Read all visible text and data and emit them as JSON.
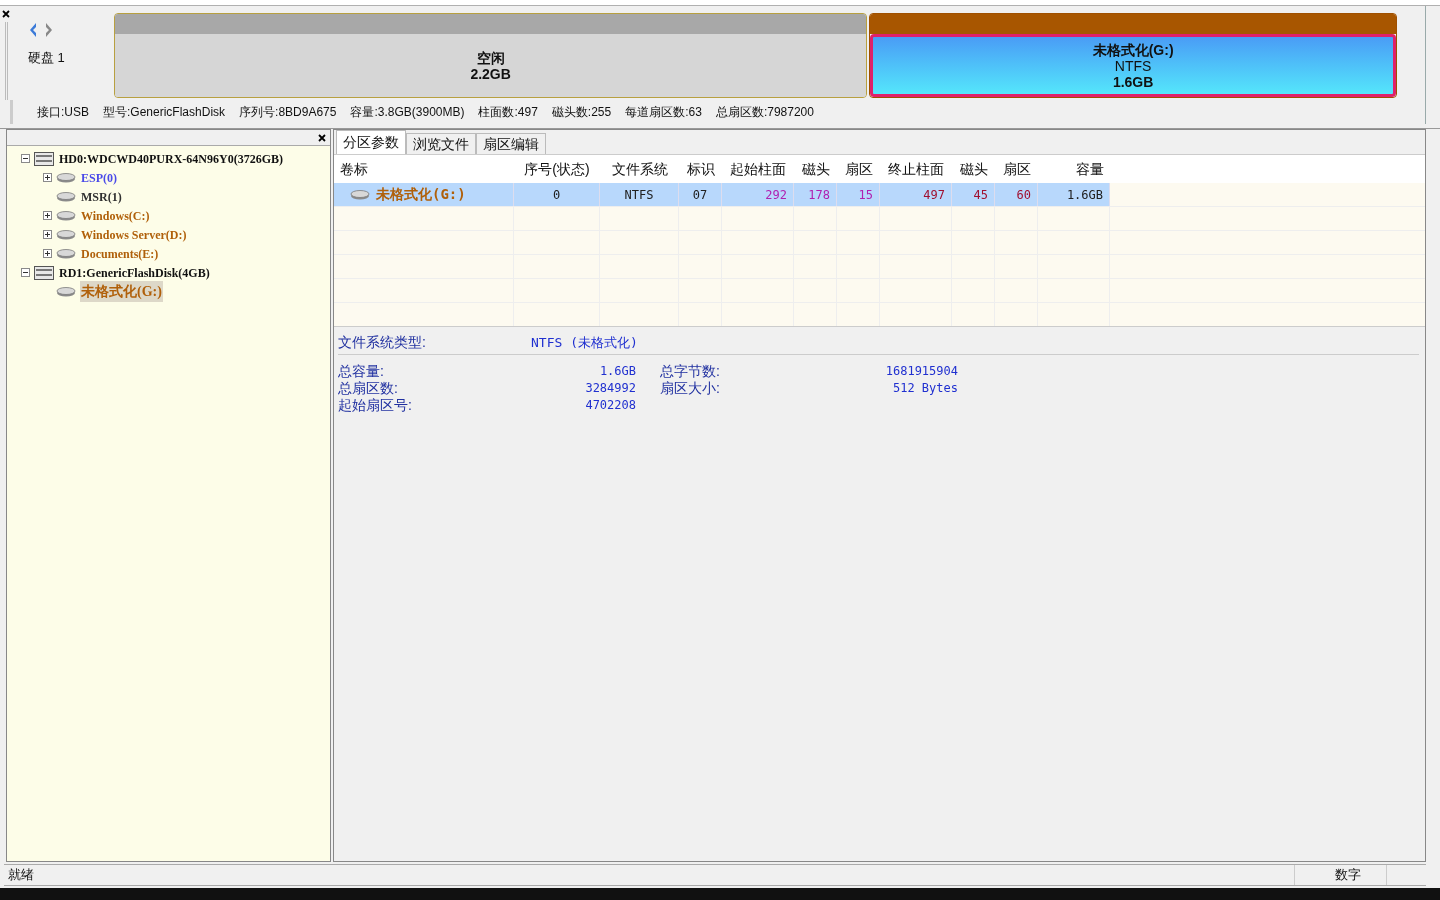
{
  "disk_panel": {
    "label": "硬盘 1",
    "partitions": [
      {
        "kind": "free",
        "name": "空闲",
        "size": "2.2GB",
        "selected": false
      },
      {
        "kind": "partition",
        "name": "未格式化(G:)",
        "fs": "NTFS",
        "size": "1.6GB",
        "selected": true
      }
    ],
    "info": [
      "接口:USB",
      "型号:GenericFlashDisk",
      "序列号:8BD9A675",
      "容量:3.8GB(3900MB)",
      "柱面数:497",
      "磁头数:255",
      "每道扇区数:63",
      "总扇区数:7987200"
    ]
  },
  "tree": [
    {
      "label": "HD0:WDCWD40PURX-64N96Y0(3726GB)",
      "selected": false,
      "expanded": true,
      "children": [
        {
          "label": "ESP(0)",
          "color": "#4a4ae8",
          "has_children": true,
          "selected": false
        },
        {
          "label": "MSR(1)",
          "color": "#303030",
          "has_children": false,
          "selected": false
        },
        {
          "label": "Windows(C:)",
          "color": "#b0600a",
          "has_children": true,
          "selected": false
        },
        {
          "label": "Windows Server(D:)",
          "color": "#b0600a",
          "has_children": true,
          "selected": false
        },
        {
          "label": "Documents(E:)",
          "color": "#b0600a",
          "has_children": true,
          "selected": false
        }
      ]
    },
    {
      "label": "RD1:GenericFlashDisk(4GB)",
      "selected": false,
      "expanded": true,
      "children": [
        {
          "label": "未格式化(G:)",
          "color": "#b0600a",
          "has_children": false,
          "selected": true
        }
      ]
    }
  ],
  "tabs": [
    {
      "label": "分区参数",
      "selected": true
    },
    {
      "label": "浏览文件",
      "selected": false
    },
    {
      "label": "扇区编辑",
      "selected": false
    }
  ],
  "table": {
    "columns": [
      "卷标",
      "序号(状态)",
      "文件系统",
      "标识",
      "起始柱面",
      "磁头",
      "扇区",
      "终止柱面",
      "磁头",
      "扇区",
      "容量"
    ],
    "rows": [
      {
        "selected": true,
        "cells": [
          {
            "text": "未格式化(G:)",
            "color": "#b0600a"
          },
          {
            "text": "0",
            "color": "#202020"
          },
          {
            "text": "NTFS",
            "color": "#202020"
          },
          {
            "text": "07",
            "color": "#202020"
          },
          {
            "text": "292",
            "color": "#b020b0"
          },
          {
            "text": "178",
            "color": "#b020b0"
          },
          {
            "text": "15",
            "color": "#b020b0"
          },
          {
            "text": "497",
            "color": "#a01030"
          },
          {
            "text": "45",
            "color": "#a01030"
          },
          {
            "text": "60",
            "color": "#a01030"
          },
          {
            "text": "1.6GB",
            "color": "#202020"
          }
        ]
      }
    ]
  },
  "details": {
    "fs_label": "文件系统类型:",
    "fs_value": "NTFS (未格式化)",
    "left": [
      {
        "label": "总容量:",
        "value": "1.6GB"
      },
      {
        "label": "总扇区数:",
        "value": "3284992"
      },
      {
        "label": "起始扇区号:",
        "value": "4702208"
      }
    ],
    "right": [
      {
        "label": "总字节数:",
        "value": "1681915904"
      },
      {
        "label": "扇区大小:",
        "value": "512 Bytes"
      }
    ]
  },
  "status_bar": [
    "就绪",
    "数字"
  ]
}
